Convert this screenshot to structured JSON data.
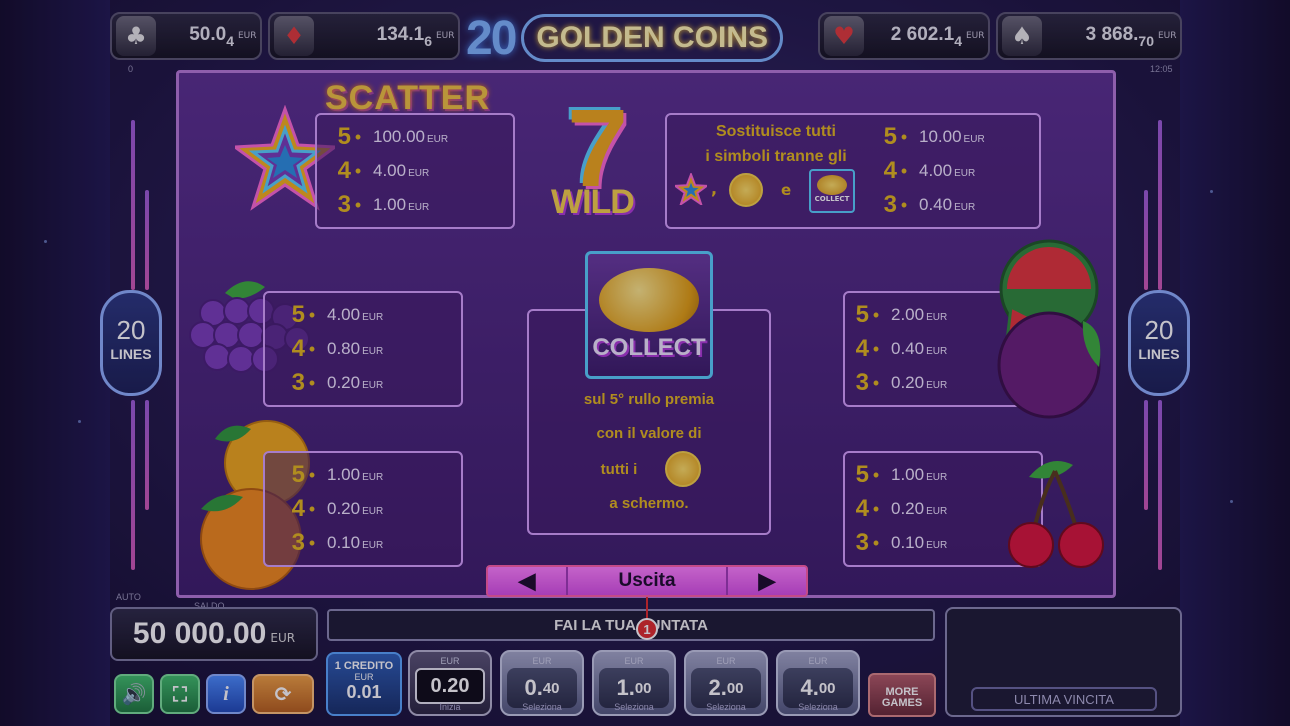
{
  "jackpots": [
    {
      "suit": "♣",
      "main": "50.0",
      "small": "4",
      "cur": "EUR"
    },
    {
      "suit": "♦",
      "main": "134.1",
      "small": "6",
      "cur": "EUR"
    },
    {
      "suit": "♥",
      "main": "2 602.1",
      "small": "4",
      "cur": "EUR"
    },
    {
      "suit": "♠",
      "main": "3 868.",
      "small": "70",
      "cur": "EUR"
    }
  ],
  "logo": {
    "number": "20",
    "title": "GOLDEN COINS"
  },
  "clock": "12:05",
  "top_left_tiny": "0",
  "lines": {
    "count": "20",
    "label": "LINES"
  },
  "scatter": {
    "title": "SCATTER",
    "rows": [
      {
        "k": "5",
        "v": "100.00",
        "u": "EUR"
      },
      {
        "k": "4",
        "v": "4.00",
        "u": "EUR"
      },
      {
        "k": "3",
        "v": "1.00",
        "u": "EUR"
      }
    ]
  },
  "wild": {
    "text1": "Sostituisce tutti",
    "text2": "i simboli tranne gli",
    "sep1": ",",
    "sep2": "e",
    "badge": "COLLECT",
    "rows": [
      {
        "k": "5",
        "v": "10.00",
        "u": "EUR"
      },
      {
        "k": "4",
        "v": "4.00",
        "u": "EUR"
      },
      {
        "k": "3",
        "v": "0.40",
        "u": "EUR"
      }
    ]
  },
  "grapes": {
    "rows": [
      {
        "k": "5",
        "v": "4.00",
        "u": "EUR"
      },
      {
        "k": "4",
        "v": "0.80",
        "u": "EUR"
      },
      {
        "k": "3",
        "v": "0.20",
        "u": "EUR"
      }
    ]
  },
  "plum": {
    "rows": [
      {
        "k": "5",
        "v": "2.00",
        "u": "EUR"
      },
      {
        "k": "4",
        "v": "0.40",
        "u": "EUR"
      },
      {
        "k": "3",
        "v": "0.20",
        "u": "EUR"
      }
    ]
  },
  "orange": {
    "rows": [
      {
        "k": "5",
        "v": "1.00",
        "u": "EUR"
      },
      {
        "k": "4",
        "v": "0.20",
        "u": "EUR"
      },
      {
        "k": "3",
        "v": "0.10",
        "u": "EUR"
      }
    ]
  },
  "cherry": {
    "rows": [
      {
        "k": "5",
        "v": "1.00",
        "u": "EUR"
      },
      {
        "k": "4",
        "v": "0.20",
        "u": "EUR"
      },
      {
        "k": "3",
        "v": "0.10",
        "u": "EUR"
      }
    ]
  },
  "collect": {
    "badge": "COLLECT",
    "line1": "sul 5° rullo premia",
    "line2": "con il valore di",
    "line3": "tutti i",
    "line4": "a schermo."
  },
  "nav": {
    "prev": "◀",
    "label": "Uscita",
    "next": "▶"
  },
  "marker": "1",
  "auto_label": "AUTO",
  "saldo": {
    "label": "SALDO",
    "value": "50 000.00",
    "cur": "EUR"
  },
  "message": "FAI LA TUA PUNTATA",
  "last_win_label": "ULTIMA VINCITA",
  "credit": {
    "line1": "1 CREDITO",
    "cur": "EUR",
    "value": "0.01"
  },
  "bets": [
    {
      "cur": "EUR",
      "amt": "0.20",
      "sub": "Inizia"
    },
    {
      "cur": "EUR",
      "amt": "0.",
      "small": "40",
      "sub": "Seleziona"
    },
    {
      "cur": "EUR",
      "amt": "1.",
      "small": "00",
      "sub": "Seleziona"
    },
    {
      "cur": "EUR",
      "amt": "2.",
      "small": "00",
      "sub": "Seleziona"
    },
    {
      "cur": "EUR",
      "amt": "4.",
      "small": "00",
      "sub": "Seleziona"
    }
  ],
  "more_games": {
    "line1": "MORE",
    "line2": "GAMES"
  },
  "icons": [
    "sound-icon",
    "fullscreen-icon",
    "info-icon",
    "autoplay-icon"
  ]
}
